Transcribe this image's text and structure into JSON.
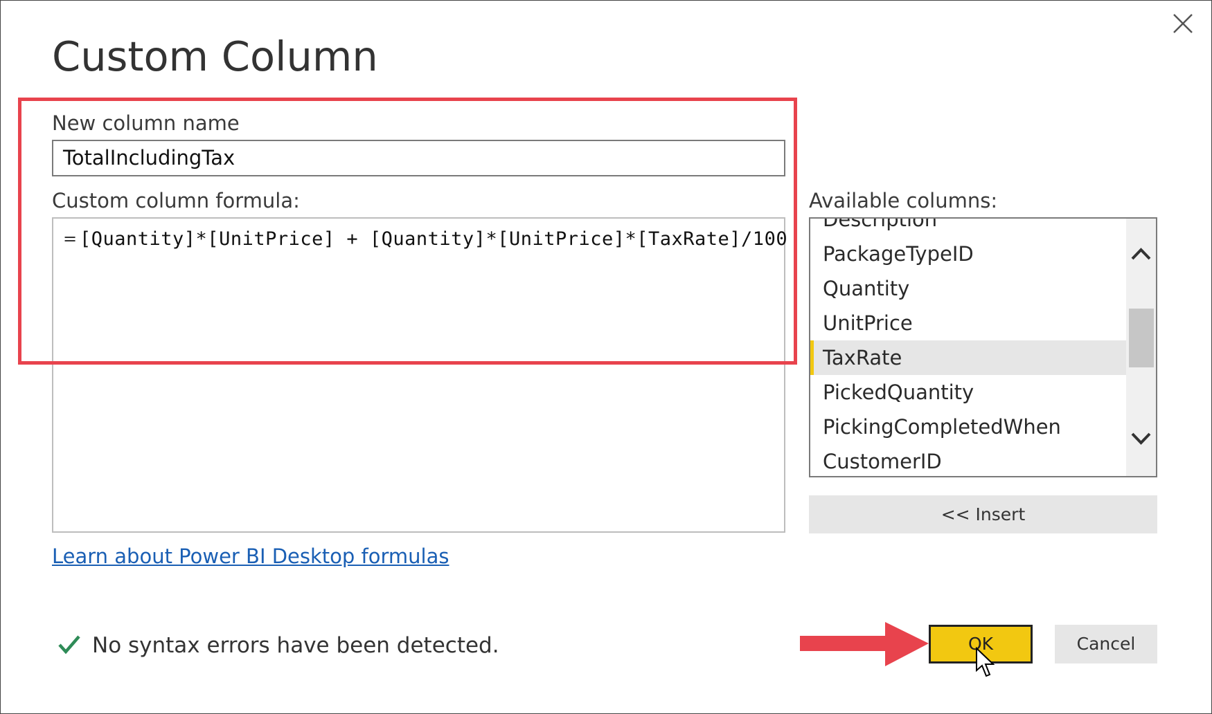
{
  "dialog": {
    "title": "Custom Column",
    "close_icon": "close-icon"
  },
  "new_column": {
    "label": "New column name",
    "value": "TotalIncludingTax"
  },
  "formula": {
    "label": "Custom column formula:",
    "prefix": "=",
    "value": "[Quantity]*[UnitPrice] + [Quantity]*[UnitPrice]*[TaxRate]/100"
  },
  "available_columns": {
    "label": "Available columns:",
    "items": [
      {
        "label": "Description"
      },
      {
        "label": "PackageTypeID"
      },
      {
        "label": "Quantity"
      },
      {
        "label": "UnitPrice"
      },
      {
        "label": "TaxRate",
        "selected": true
      },
      {
        "label": "PickedQuantity"
      },
      {
        "label": "PickingCompletedWhen"
      },
      {
        "label": "CustomerID"
      }
    ],
    "insert_label": "<< Insert"
  },
  "link": {
    "text": "Learn about Power BI Desktop formulas"
  },
  "status": {
    "text": "No syntax errors have been detected.",
    "icon": "checkmark-icon"
  },
  "buttons": {
    "ok_label": "OK",
    "cancel_label": "Cancel"
  },
  "colors": {
    "accent_yellow": "#f2c811",
    "highlight_red": "#e8434d",
    "link_blue": "#1a5fb4",
    "check_green": "#2e8b57"
  }
}
